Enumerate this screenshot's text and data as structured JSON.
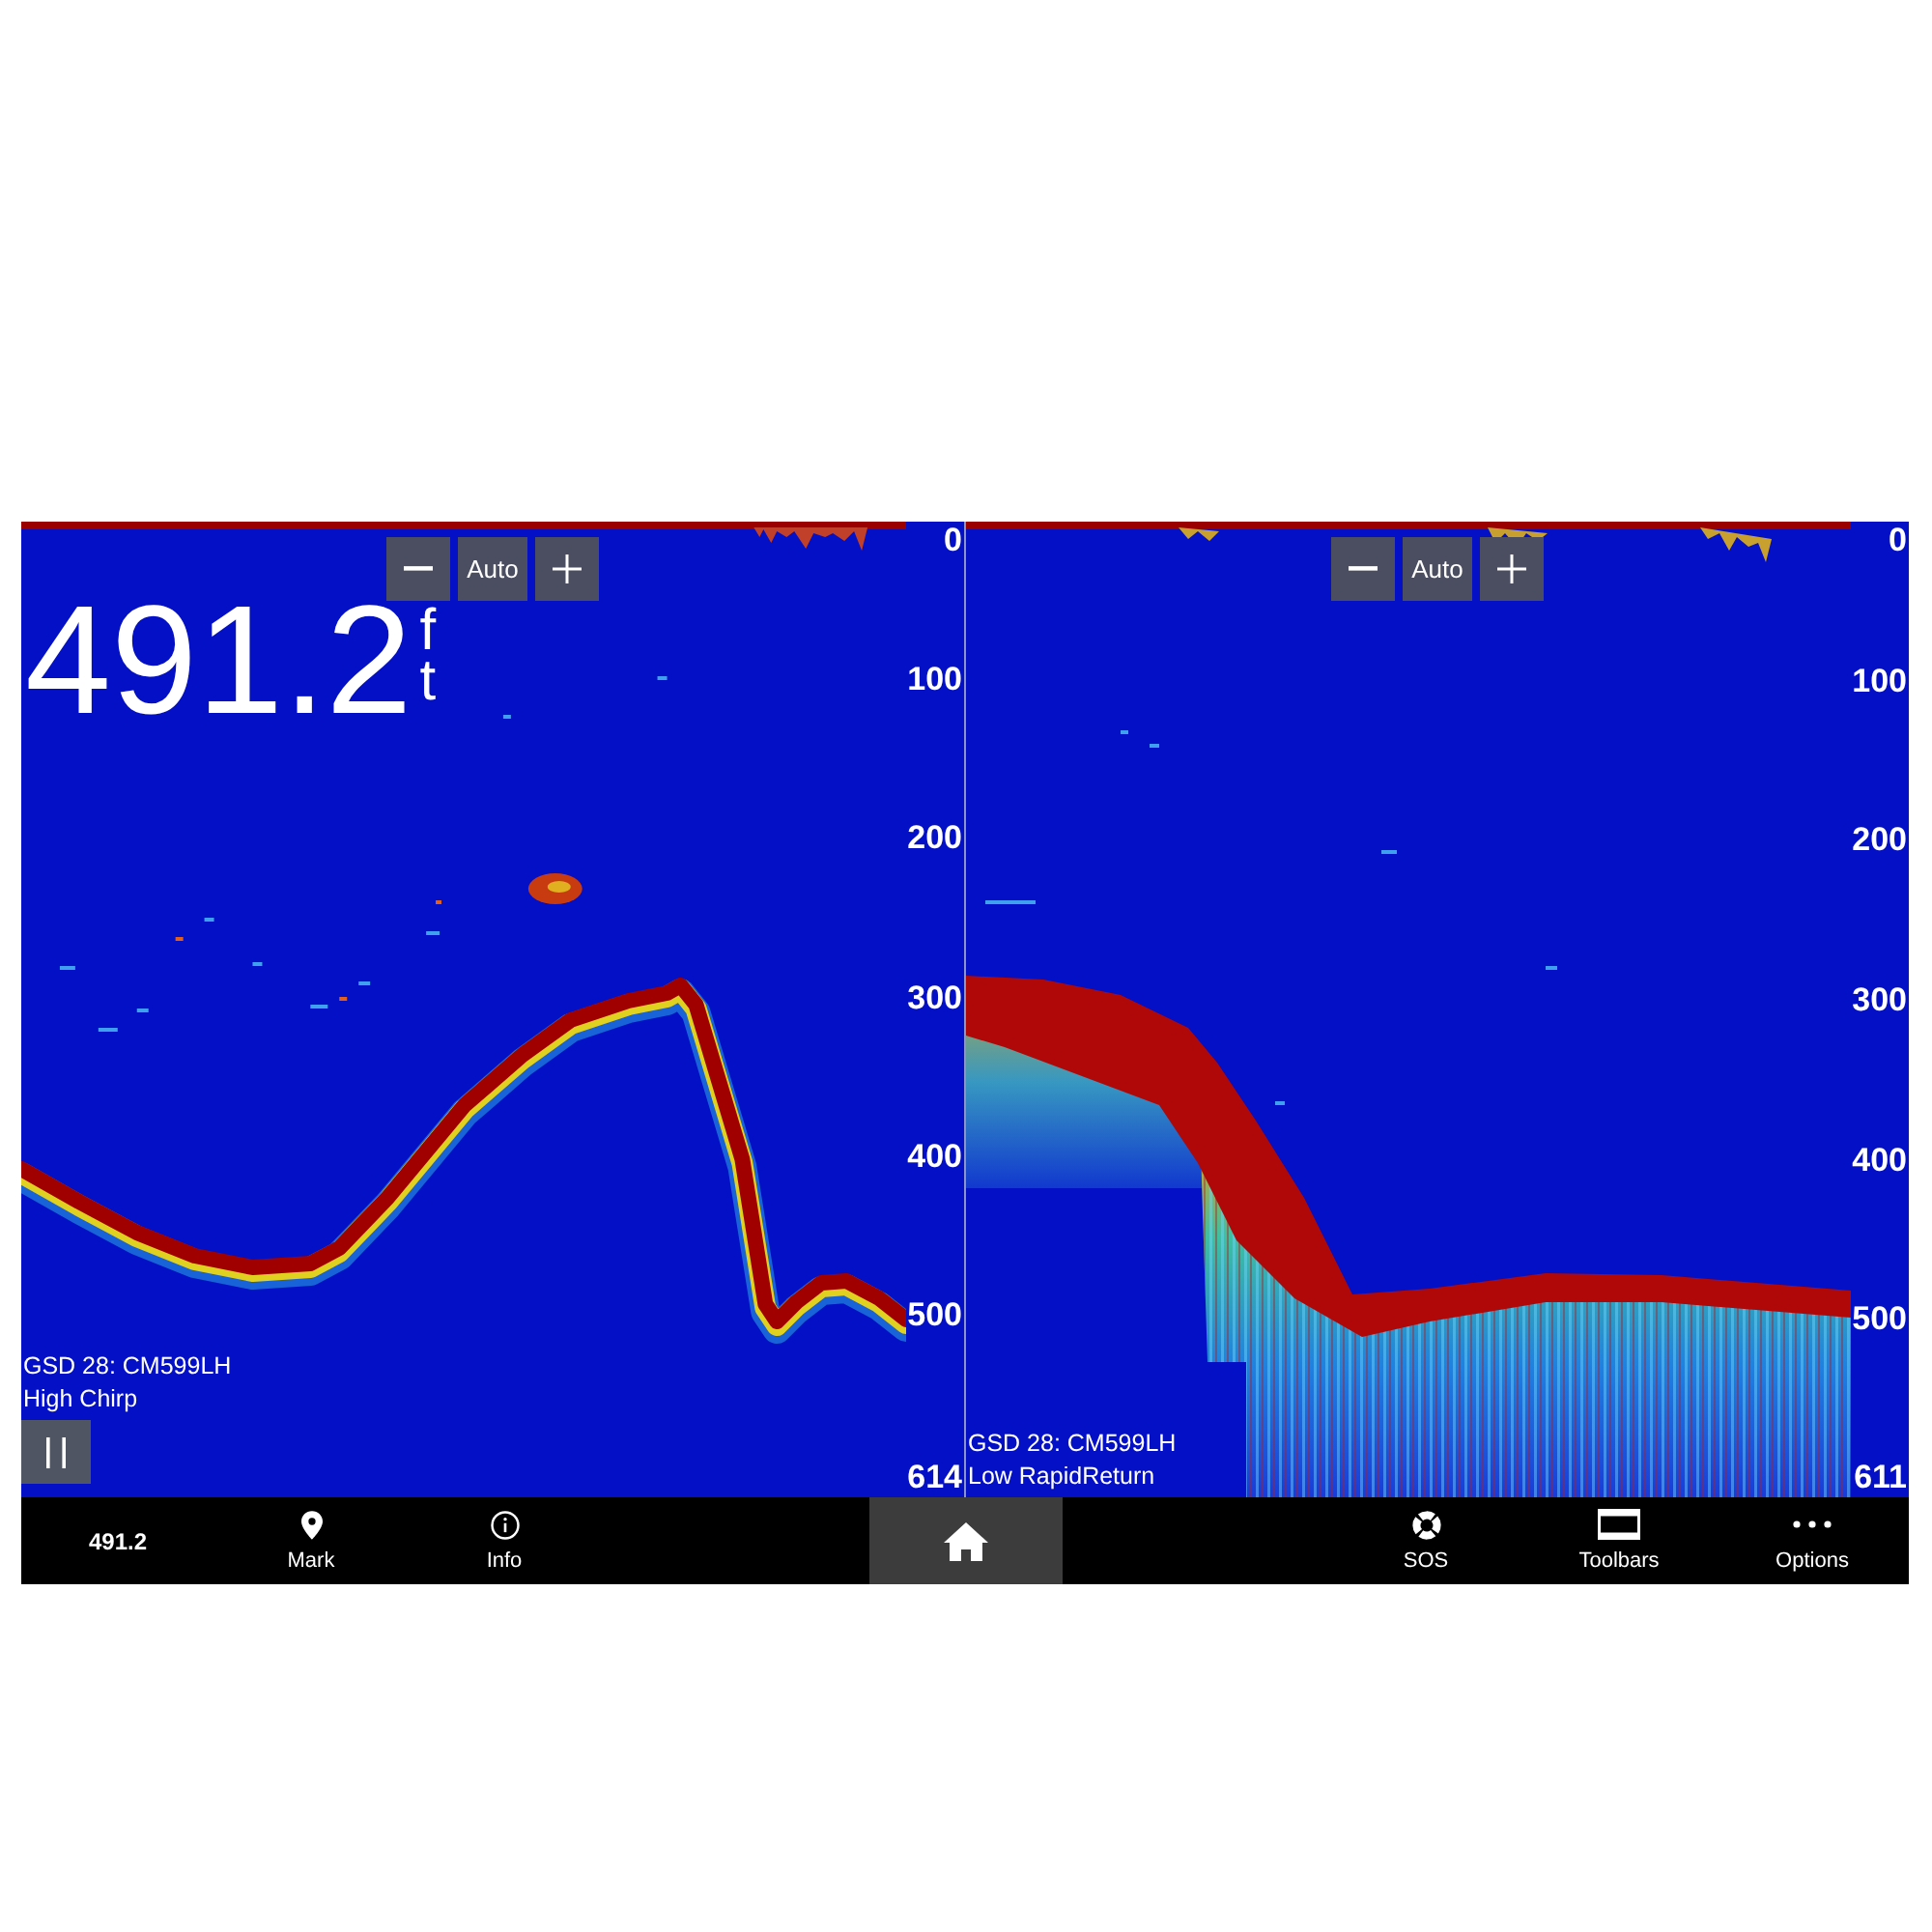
{
  "panels": [
    {
      "kind": "chirp",
      "zoom": {
        "label": "Auto"
      },
      "depth": {
        "value": "491.2",
        "unit": "ft"
      },
      "scale": [
        "0",
        "100",
        "200",
        "300",
        "400",
        "500",
        "614"
      ],
      "transducer": "GSD 28: CM599LH",
      "mode": "High Chirp",
      "pause_control": true
    },
    {
      "kind": "rapidreturn",
      "zoom": {
        "label": "Auto"
      },
      "scale": [
        "0",
        "100",
        "200",
        "300",
        "400",
        "500",
        "611"
      ],
      "transducer": "GSD 28: CM599LH",
      "mode": "Low RapidReturn"
    }
  ],
  "bottom_bar": {
    "depth": "491.2",
    "left_items": [
      {
        "kind": "pin",
        "label": "Mark"
      },
      {
        "kind": "info",
        "label": "Info"
      }
    ],
    "right_items": [
      {
        "kind": "sos",
        "label": "SOS"
      },
      {
        "kind": "toolbars",
        "label": "Toolbars"
      },
      {
        "kind": "options",
        "label": "Options"
      }
    ]
  }
}
